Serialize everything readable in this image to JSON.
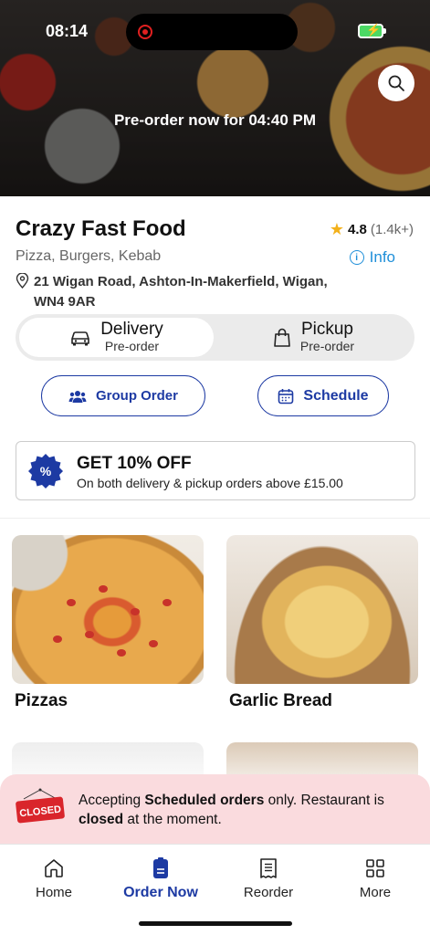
{
  "status_bar": {
    "time": "08:14",
    "battery_icon": "battery-charging-icon"
  },
  "hero": {
    "banner": "Pre-order now for 04:40 PM"
  },
  "restaurant": {
    "name": "Crazy Fast Food",
    "rating": "4.8",
    "rating_count": "(1.4k+)",
    "cuisine": "Pizza, Burgers, Kebab",
    "info_label": "Info",
    "address": "21 Wigan Road, Ashton-In-Makerfield, Wigan, WN4 9AR"
  },
  "modes": [
    {
      "title": "Delivery",
      "subtitle": "Pre-order",
      "icon": "car-icon",
      "active": true
    },
    {
      "title": "Pickup",
      "subtitle": "Pre-order",
      "icon": "shopping-bag-icon",
      "active": false
    }
  ],
  "actions": {
    "group_order": "Group Order",
    "schedule": "Schedule"
  },
  "promo": {
    "badge": "%",
    "title": "GET 10% OFF",
    "subtitle": "On both delivery & pickup orders above £15.00"
  },
  "categories": [
    {
      "label": "Pizzas"
    },
    {
      "label": "Garlic Bread"
    }
  ],
  "closed_notice": {
    "sign": "CLOSED",
    "text_1": "Accepting ",
    "text_bold_1": "Scheduled orders",
    "text_2": " only. Restaurant is ",
    "text_bold_2": "closed",
    "text_3": " at the moment."
  },
  "tabs": [
    {
      "label": "Home",
      "icon": "home-icon",
      "active": false
    },
    {
      "label": "Order Now",
      "icon": "order-icon",
      "active": true
    },
    {
      "label": "Reorder",
      "icon": "receipt-icon",
      "active": false
    },
    {
      "label": "More",
      "icon": "grid-icon",
      "active": false
    }
  ],
  "colors": {
    "brand": "#1d3aa3",
    "info": "#1f8fd9",
    "closed_bg": "#fadbde",
    "closed_sign": "#d9252b",
    "star": "#f3b11b"
  }
}
